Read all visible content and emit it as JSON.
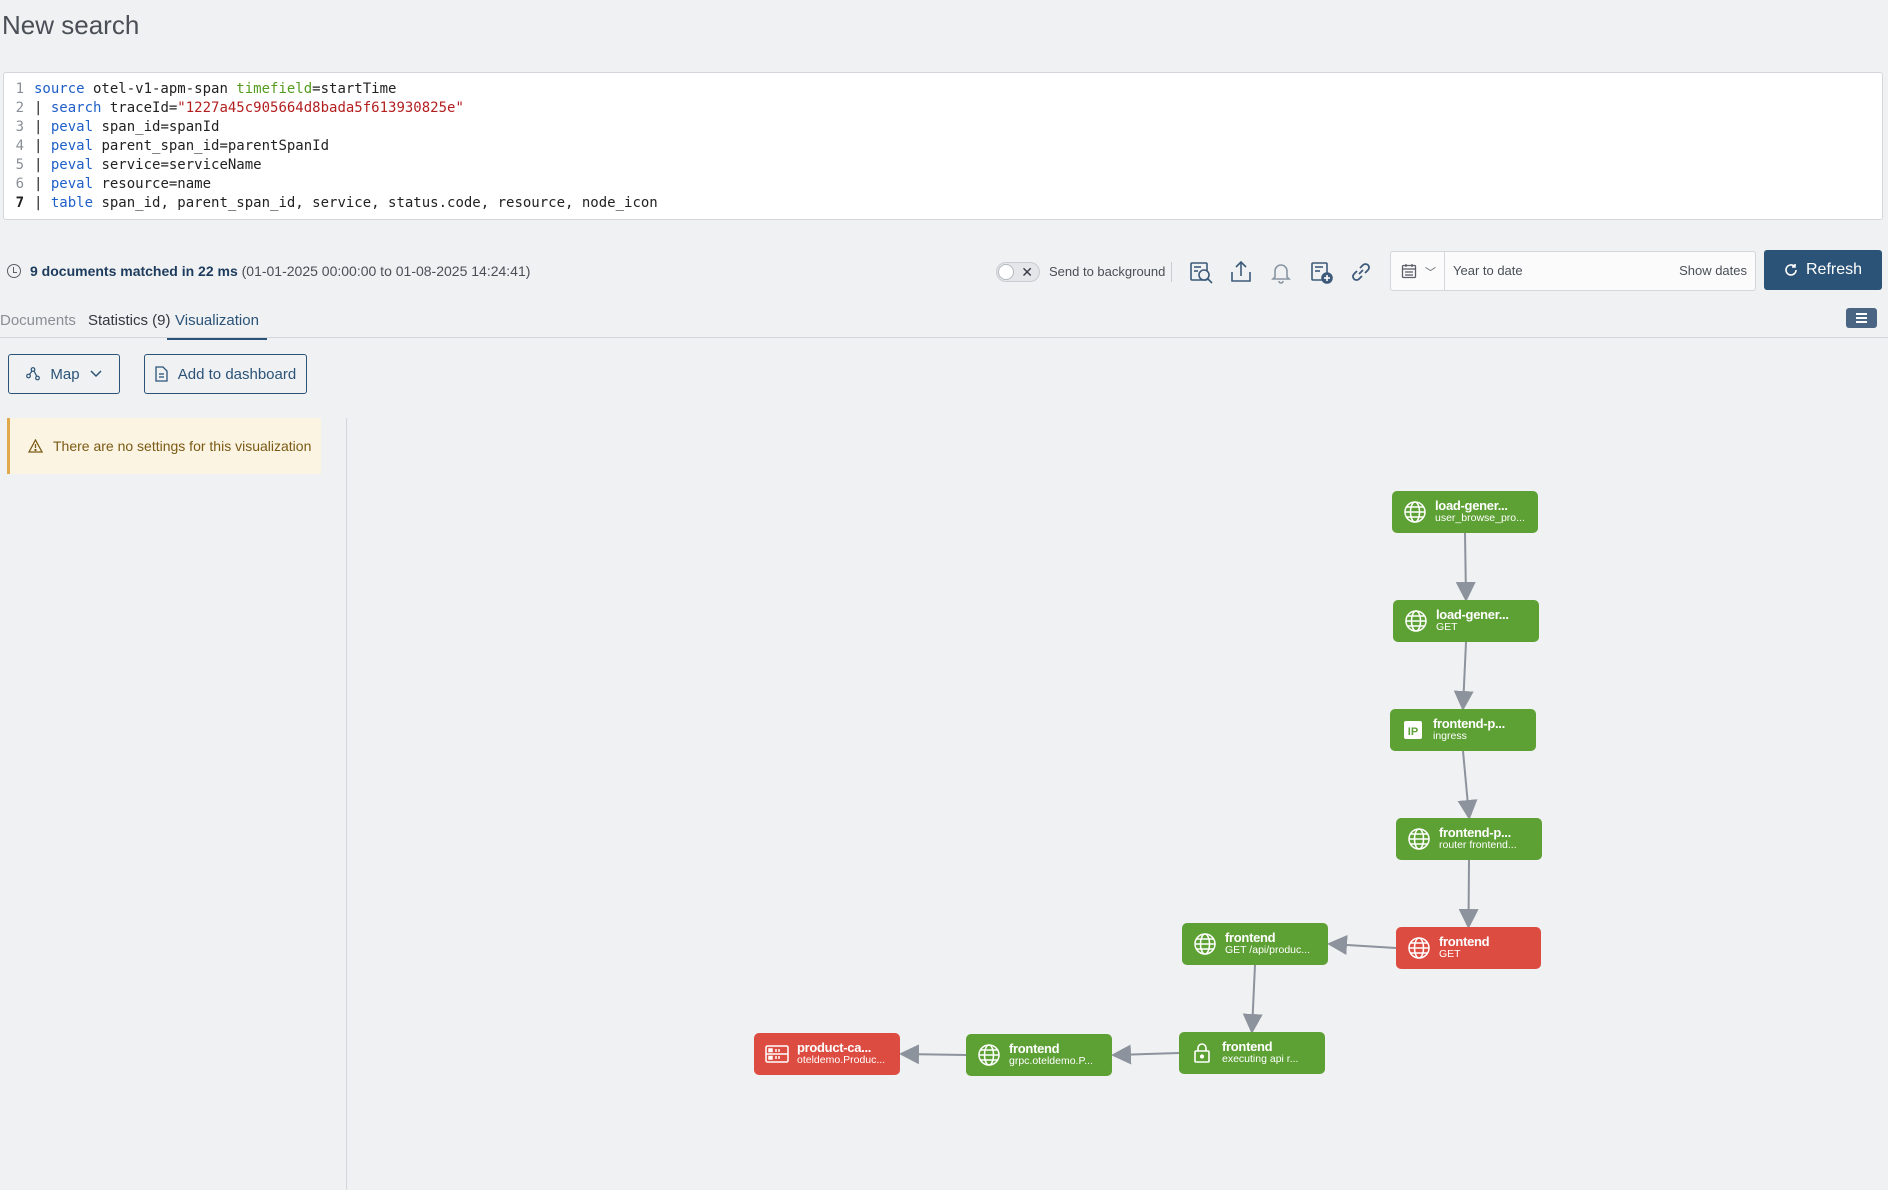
{
  "page_title": "New search",
  "query_lines": [
    {
      "num": "1",
      "tokens": [
        {
          "t": "source",
          "c": "kw"
        },
        {
          "t": " otel-v1-apm-span ",
          "c": "plain"
        },
        {
          "t": "timefield",
          "c": "opt"
        },
        {
          "t": "=startTime",
          "c": "plain"
        }
      ]
    },
    {
      "num": "2",
      "tokens": [
        {
          "t": "| ",
          "c": "pipe"
        },
        {
          "t": "search",
          "c": "kw"
        },
        {
          "t": " traceId=",
          "c": "plain"
        },
        {
          "t": "\"1227a45c905664d8bada5f613930825e\"",
          "c": "str"
        }
      ]
    },
    {
      "num": "3",
      "tokens": [
        {
          "t": "| ",
          "c": "pipe"
        },
        {
          "t": "peval",
          "c": "kw"
        },
        {
          "t": " span_id=spanId",
          "c": "plain"
        }
      ]
    },
    {
      "num": "4",
      "tokens": [
        {
          "t": "| ",
          "c": "pipe"
        },
        {
          "t": "peval",
          "c": "kw"
        },
        {
          "t": " parent_span_id=parentSpanId",
          "c": "plain"
        }
      ]
    },
    {
      "num": "5",
      "tokens": [
        {
          "t": "| ",
          "c": "pipe"
        },
        {
          "t": "peval",
          "c": "kw"
        },
        {
          "t": " service=serviceName",
          "c": "plain"
        }
      ]
    },
    {
      "num": "6",
      "tokens": [
        {
          "t": "| ",
          "c": "pipe"
        },
        {
          "t": "peval",
          "c": "kw"
        },
        {
          "t": " resource=name",
          "c": "plain"
        }
      ]
    },
    {
      "num": "7",
      "tokens": [
        {
          "t": "| ",
          "c": "pipe"
        },
        {
          "t": "table",
          "c": "kw"
        },
        {
          "t": " span_id, parent_span_id, service, status.code, resource, node_icon",
          "c": "plain"
        }
      ]
    }
  ],
  "status": {
    "matched": "9 documents matched in 22 ms",
    "range": " (01-01-2025 00:00:00 to 01-08-2025 14:24:41)",
    "background_label": "Send to background",
    "date_value": "Year to date",
    "show_dates": "Show dates",
    "refresh": "Refresh"
  },
  "tabs": {
    "documents": "Documents",
    "statistics": "Statistics (9)",
    "visualization": "Visualization"
  },
  "controls": {
    "map": "Map",
    "add_dashboard": "Add to dashboard",
    "warning": "There are no settings for this visualization"
  },
  "colors": {
    "ok": "#5da033",
    "error": "#dd4c41",
    "accent": "#2b5378"
  },
  "nodes": [
    {
      "id": "n1",
      "title": "load-gener...",
      "sub": "user_browse_pro...",
      "status": "ok",
      "icon": "globe-icon"
    },
    {
      "id": "n2",
      "title": "load-gener...",
      "sub": "GET",
      "status": "ok",
      "icon": "globe-icon"
    },
    {
      "id": "n3",
      "title": "frontend-p...",
      "sub": "ingress",
      "status": "ok",
      "icon": "ip-icon"
    },
    {
      "id": "n4",
      "title": "frontend-p...",
      "sub": "router frontend...",
      "status": "ok",
      "icon": "globe-icon"
    },
    {
      "id": "n5",
      "title": "frontend",
      "sub": "GET",
      "status": "error",
      "icon": "globe-icon"
    },
    {
      "id": "n6",
      "title": "frontend",
      "sub": "GET /api/produc...",
      "status": "ok",
      "icon": "globe-icon"
    },
    {
      "id": "n7",
      "title": "frontend",
      "sub": "executing api r...",
      "status": "ok",
      "icon": "lock-icon"
    },
    {
      "id": "n8",
      "title": "frontend",
      "sub": "grpc.oteldemo.P...",
      "status": "ok",
      "icon": "globe-icon"
    },
    {
      "id": "n9",
      "title": "product-ca...",
      "sub": "oteldemo.Produc...",
      "status": "error",
      "icon": "server-icon"
    }
  ],
  "edges": [
    [
      "n1",
      "n2"
    ],
    [
      "n2",
      "n3"
    ],
    [
      "n3",
      "n4"
    ],
    [
      "n4",
      "n5"
    ],
    [
      "n5",
      "n6"
    ],
    [
      "n6",
      "n7"
    ],
    [
      "n7",
      "n8"
    ],
    [
      "n8",
      "n9"
    ]
  ]
}
